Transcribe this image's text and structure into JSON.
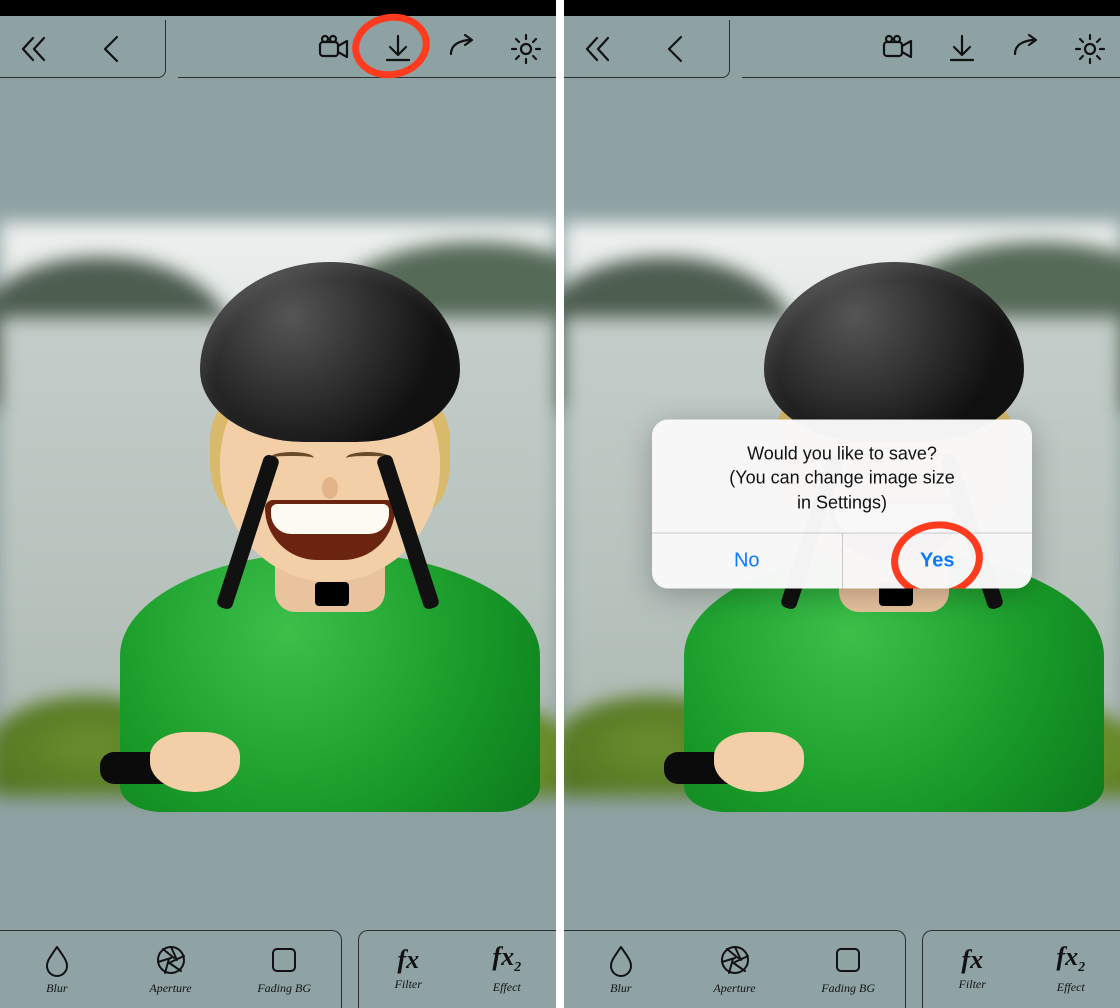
{
  "icons": {
    "back_all": "double-chevron-left-icon",
    "back": "chevron-left-icon",
    "camera": "video-camera-icon",
    "download": "download-icon",
    "share": "share-icon",
    "settings": "gear-icon"
  },
  "bottom": {
    "left": [
      {
        "key": "blur",
        "label": "Blur",
        "icon": "drop-icon"
      },
      {
        "key": "aperture",
        "label": "Aperture",
        "icon": "aperture-icon"
      },
      {
        "key": "fading_bg",
        "label": "Fading BG",
        "icon": "square-icon"
      }
    ],
    "right": [
      {
        "key": "filter",
        "label": "Filter",
        "fx": "fx"
      },
      {
        "key": "effect",
        "label": "Effect",
        "fx": "fx2"
      }
    ]
  },
  "dialog": {
    "line1": "Would you like to save?",
    "line2": "(You can change image size",
    "line3": "in Settings)",
    "no": "No",
    "yes": "Yes"
  },
  "annotations": {
    "left_pane": "circle-on-download-icon",
    "right_pane": "circle-on-yes-button"
  }
}
